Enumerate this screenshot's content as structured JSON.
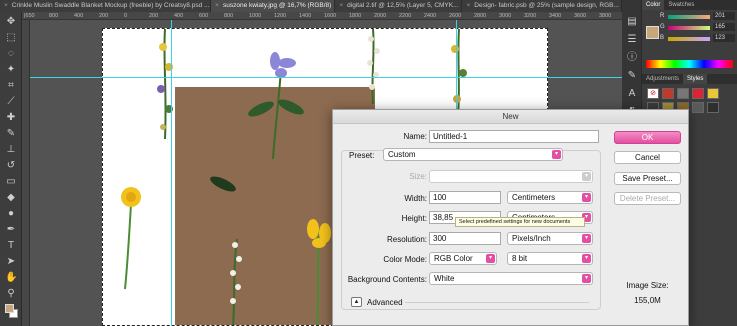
{
  "tabs": [
    {
      "label": "Crinkle Muslin Swaddle Blanket Mockup (freebie) by Creatsy8.psd ...",
      "active": false
    },
    {
      "label": "suszone kwiaty.jpg @ 16,7% (RGB/8)",
      "active": true
    },
    {
      "label": "digital 2.tif @ 12,5% (Layer 5, CMYK...",
      "active": false
    },
    {
      "label": "Design- fabric.psb @ 25% (sample design, RGB...",
      "active": false
    }
  ],
  "ruler": {
    "top": [
      "|650",
      "800",
      "400",
      "200",
      "0",
      "200",
      "400",
      "600",
      "800",
      "1000",
      "1200",
      "1400",
      "1600",
      "1800",
      "2000",
      "2200",
      "2400",
      "2600",
      "2800",
      "3000",
      "3200",
      "3400",
      "3600",
      "3800"
    ]
  },
  "panels": {
    "color_tabs": [
      "Color",
      "Swatches"
    ],
    "rgb": [
      {
        "label": "R",
        "value": "201",
        "color": "#ff0000"
      },
      {
        "label": "G",
        "value": "165",
        "color": "#00c000"
      },
      {
        "label": "B",
        "value": "123",
        "color": "#0060ff"
      }
    ],
    "adjust_tabs": [
      "Adjustments",
      "Styles"
    ],
    "foreground_color": "#c9a57a"
  },
  "dialog": {
    "title": "New",
    "name_label": "Name:",
    "name_value": "Untitled-1",
    "preset_label": "Preset:",
    "preset_value": "Custom",
    "size_label": "Size:",
    "size_value": "",
    "width_label": "Width:",
    "width_value": "100",
    "width_unit": "Centimeters",
    "height_label": "Height:",
    "height_value": "38,85",
    "height_unit": "Centimeters",
    "resolution_label": "Resolution:",
    "resolution_value": "300",
    "resolution_unit": "Pixels/Inch",
    "color_mode_label": "Color Mode:",
    "color_mode_value": "RGB Color",
    "bit_depth_value": "8 bit",
    "background_label": "Background Contents:",
    "background_value": "White",
    "advanced_label": "Advanced",
    "tooltip": "Select predefined settings for new documents",
    "ok_label": "OK",
    "cancel_label": "Cancel",
    "save_preset_label": "Save Preset...",
    "delete_preset_label": "Delete Preset...",
    "image_size_label": "Image Size:",
    "image_size_value": "155,0M",
    "accent_color": "#e44fa1"
  }
}
